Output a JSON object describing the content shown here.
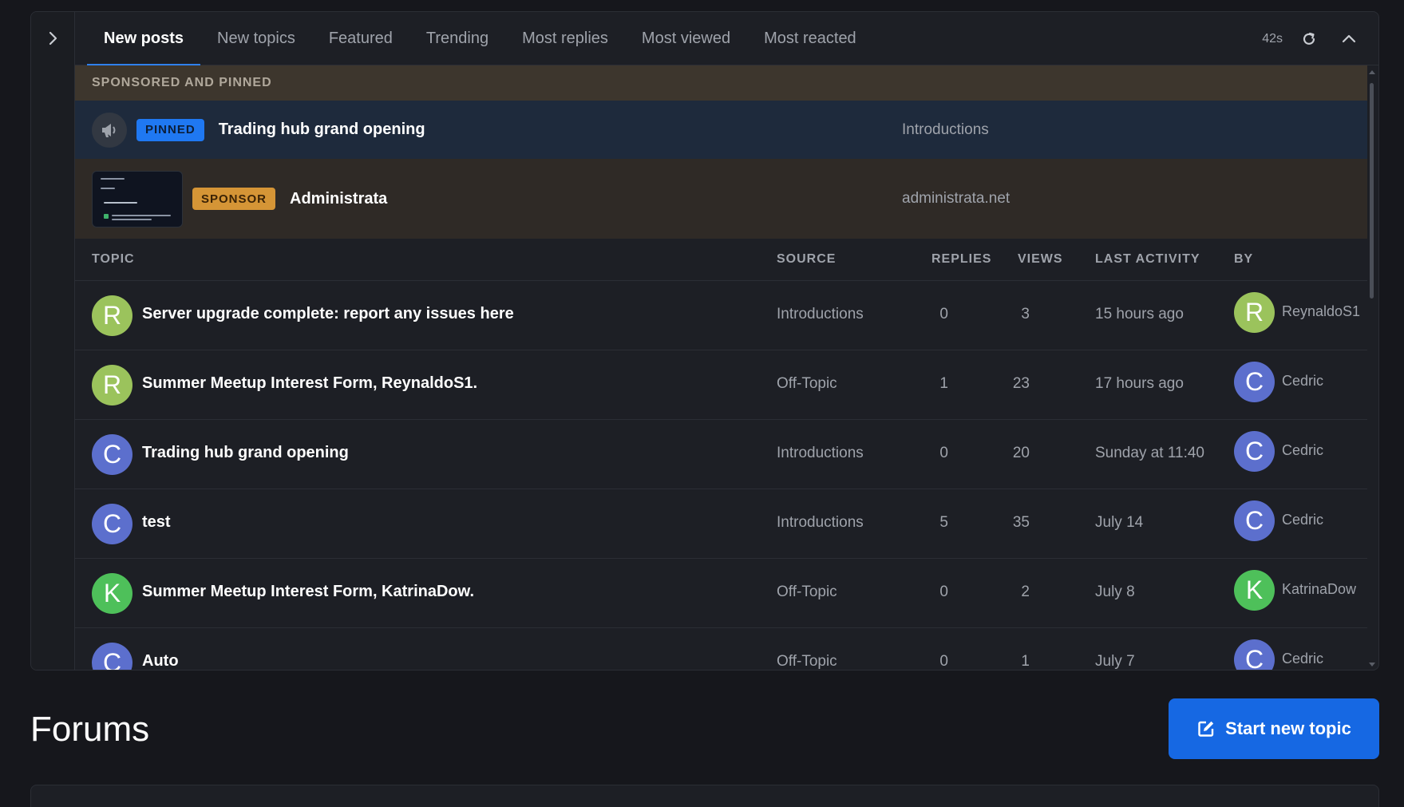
{
  "tabs": [
    "New posts",
    "New topics",
    "Featured",
    "Trending",
    "Most replies",
    "Most viewed",
    "Most reacted"
  ],
  "active_tab_index": 0,
  "timer": "42s",
  "sponsored_section": {
    "header": "SPONSORED AND PINNED",
    "pinned": {
      "badge": "PINNED",
      "title": "Trading hub grand opening",
      "source": "Introductions",
      "icon": "megaphone-icon"
    },
    "sponsor": {
      "badge": "SPONSOR",
      "title": "Administrata",
      "source": "administrata.net"
    }
  },
  "columns": {
    "topic": "TOPIC",
    "source": "SOURCE",
    "replies": "REPLIES",
    "views": "VIEWS",
    "last_activity": "LAST ACTIVITY",
    "by": "BY"
  },
  "topics": [
    {
      "avatar": "R",
      "avatar_color": "#9bc35c",
      "title": "Server upgrade complete: report any issues here",
      "source": "Introductions",
      "replies": "0",
      "views": "3",
      "last_activity": "15 hours ago",
      "by_avatar": "R",
      "by_color": "#9bc35c",
      "by": "ReynaldoS1"
    },
    {
      "avatar": "R",
      "avatar_color": "#9bc35c",
      "title": "Summer Meetup Interest Form, ReynaldoS1.",
      "source": "Off-Topic",
      "replies": "1",
      "views": "23",
      "last_activity": "17 hours ago",
      "by_avatar": "C",
      "by_color": "#5c6fcd",
      "by": "Cedric"
    },
    {
      "avatar": "C",
      "avatar_color": "#5c6fcd",
      "title": "Trading hub grand opening",
      "source": "Introductions",
      "replies": "0",
      "views": "20",
      "last_activity": "Sunday at 11:40",
      "by_avatar": "C",
      "by_color": "#5c6fcd",
      "by": "Cedric"
    },
    {
      "avatar": "C",
      "avatar_color": "#5c6fcd",
      "title": "test",
      "source": "Introductions",
      "replies": "5",
      "views": "35",
      "last_activity": "July 14",
      "by_avatar": "C",
      "by_color": "#5c6fcd",
      "by": "Cedric"
    },
    {
      "avatar": "K",
      "avatar_color": "#4ec05a",
      "title": "Summer Meetup Interest Form, KatrinaDow.",
      "source": "Off-Topic",
      "replies": "0",
      "views": "2",
      "last_activity": "July 8",
      "by_avatar": "K",
      "by_color": "#4ec05a",
      "by": "KatrinaDow"
    },
    {
      "avatar": "C",
      "avatar_color": "#5c6fcd",
      "title": "Auto",
      "source": "Off-Topic",
      "replies": "0",
      "views": "1",
      "last_activity": "July 7",
      "by_avatar": "C",
      "by_color": "#5c6fcd",
      "by": "Cedric"
    }
  ],
  "forums": {
    "title": "Forums",
    "new_topic_button": "Start new topic"
  }
}
